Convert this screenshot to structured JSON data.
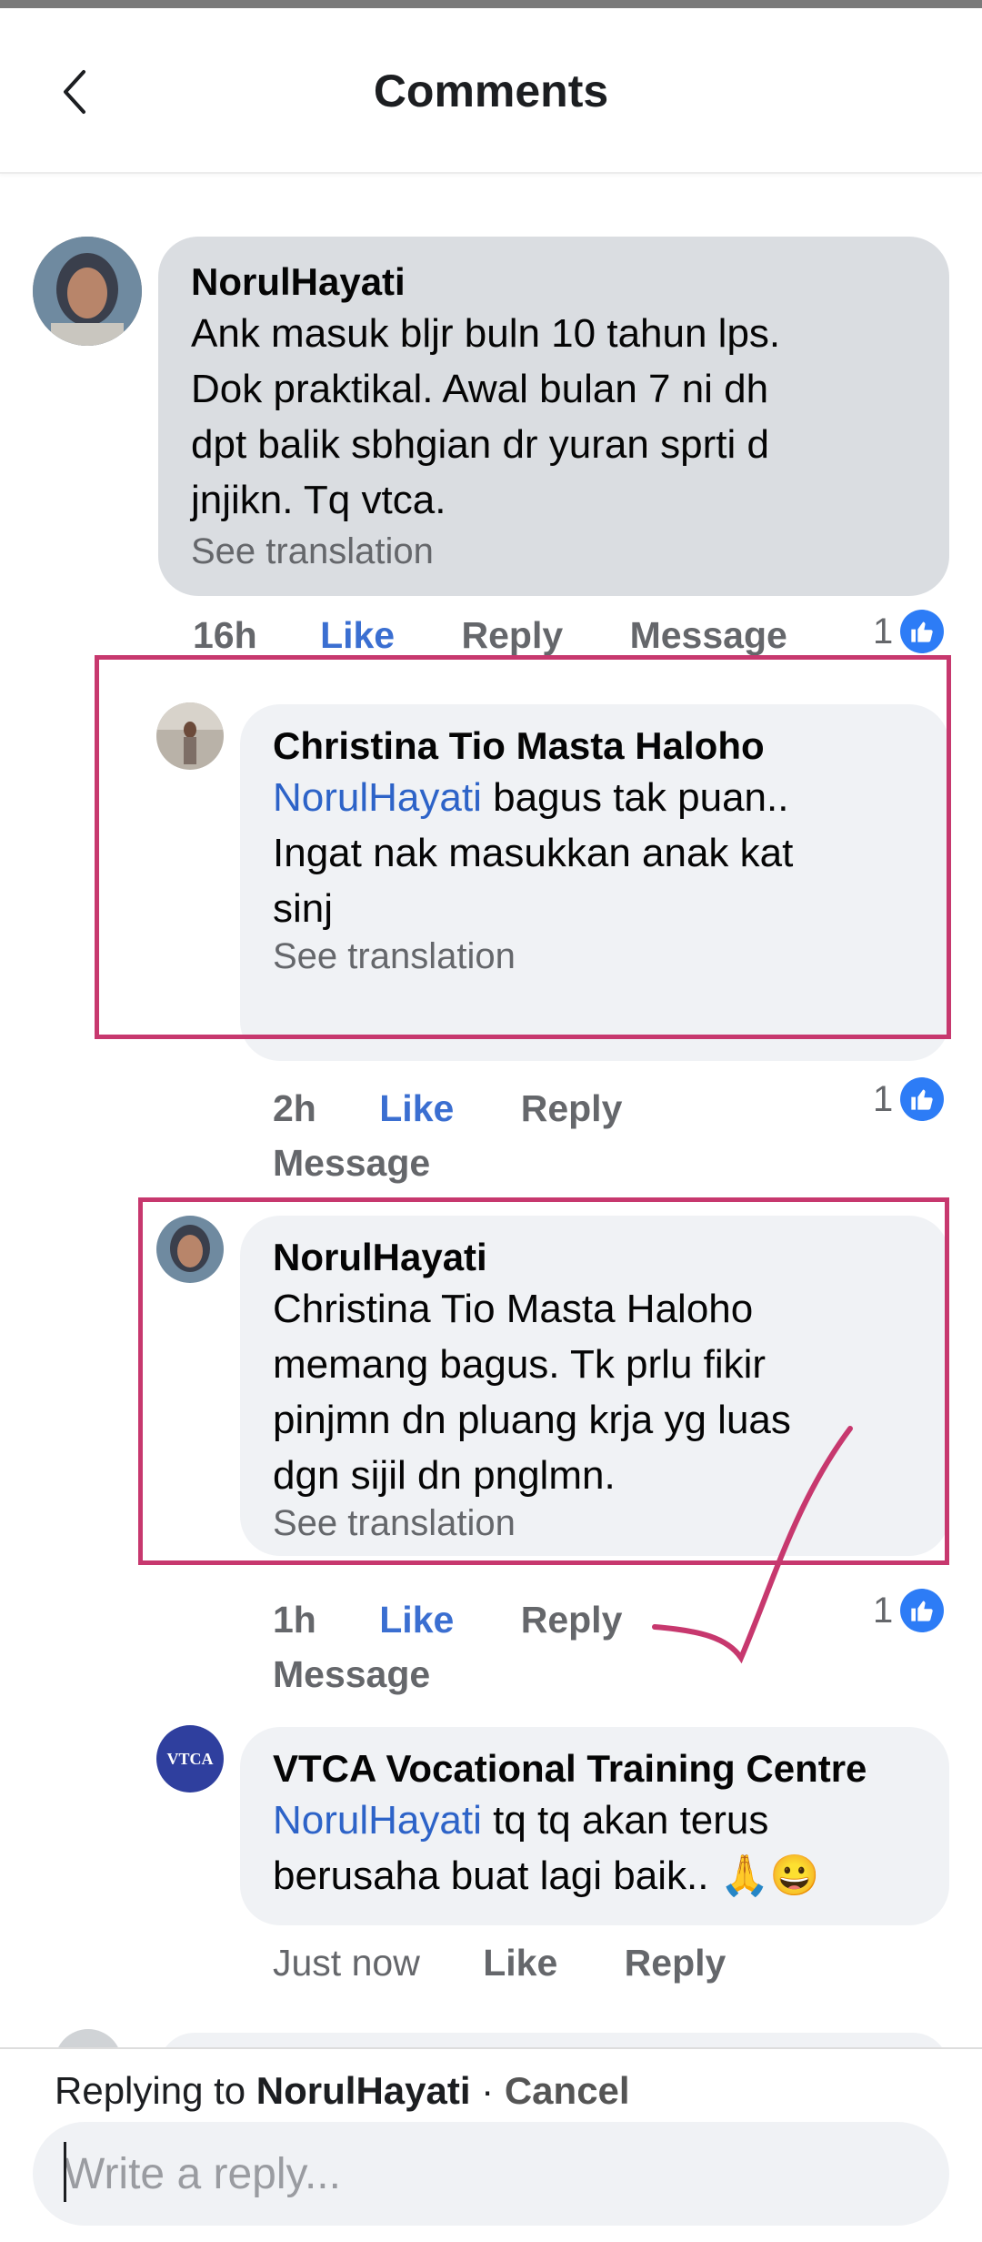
{
  "header": {
    "title": "Comments",
    "back_label": "back"
  },
  "comments": [
    {
      "author": "NorulHayati",
      "text": "Ank masuk bljr buln 10 tahun lps.\nDok praktikal. Awal bulan 7 ni dh\ndpt balik sbhgian dr yuran sprti d\njnjikn.  Tq vtca.",
      "see_translation": "See translation",
      "time": "16h",
      "like": "Like",
      "reply": "Reply",
      "message": "Message",
      "likes": "1"
    },
    {
      "author": "Christina Tio Masta Haloho",
      "mention": "NorulHayati",
      "text_after_mention": " bagus tak puan..",
      "text_more": "\n Ingat nak masukkan anak kat\nsinj",
      "see_translation": "See translation",
      "time": "2h",
      "like": "Like",
      "reply": "Reply",
      "message": "Message",
      "likes": "1"
    },
    {
      "author": "NorulHayati",
      "mention": "Christina Tio Masta Haloho",
      "text": "memang bagus. Tk prlu fikir\npinjmn dn pluang krja yg luas\ndgn sijil dn pnglmn.",
      "see_translation": "See translation",
      "time": "1h",
      "like": "Like",
      "reply": "Reply",
      "message": "Message",
      "likes": "1"
    },
    {
      "author": "VTCA Vocational Training Centre",
      "mention": "NorulHayati",
      "text_after_mention": " tq tq akan terus",
      "text_more": "berusaha buat lagi baik.. 🙏😀",
      "avatar_text": "VTCA",
      "time": "Just now",
      "like": "Like",
      "reply": "Reply"
    }
  ],
  "footer": {
    "replying_prefix": "Replying to ",
    "replying_name": "NorulHayati",
    "separator": " · ",
    "cancel": "Cancel",
    "placeholder": "Write a reply..."
  },
  "colors": {
    "accent": "#3b6fd1",
    "annotation": "#c7386e",
    "bubble_gray": "#dadde1",
    "bubble_light": "#f0f2f5"
  }
}
